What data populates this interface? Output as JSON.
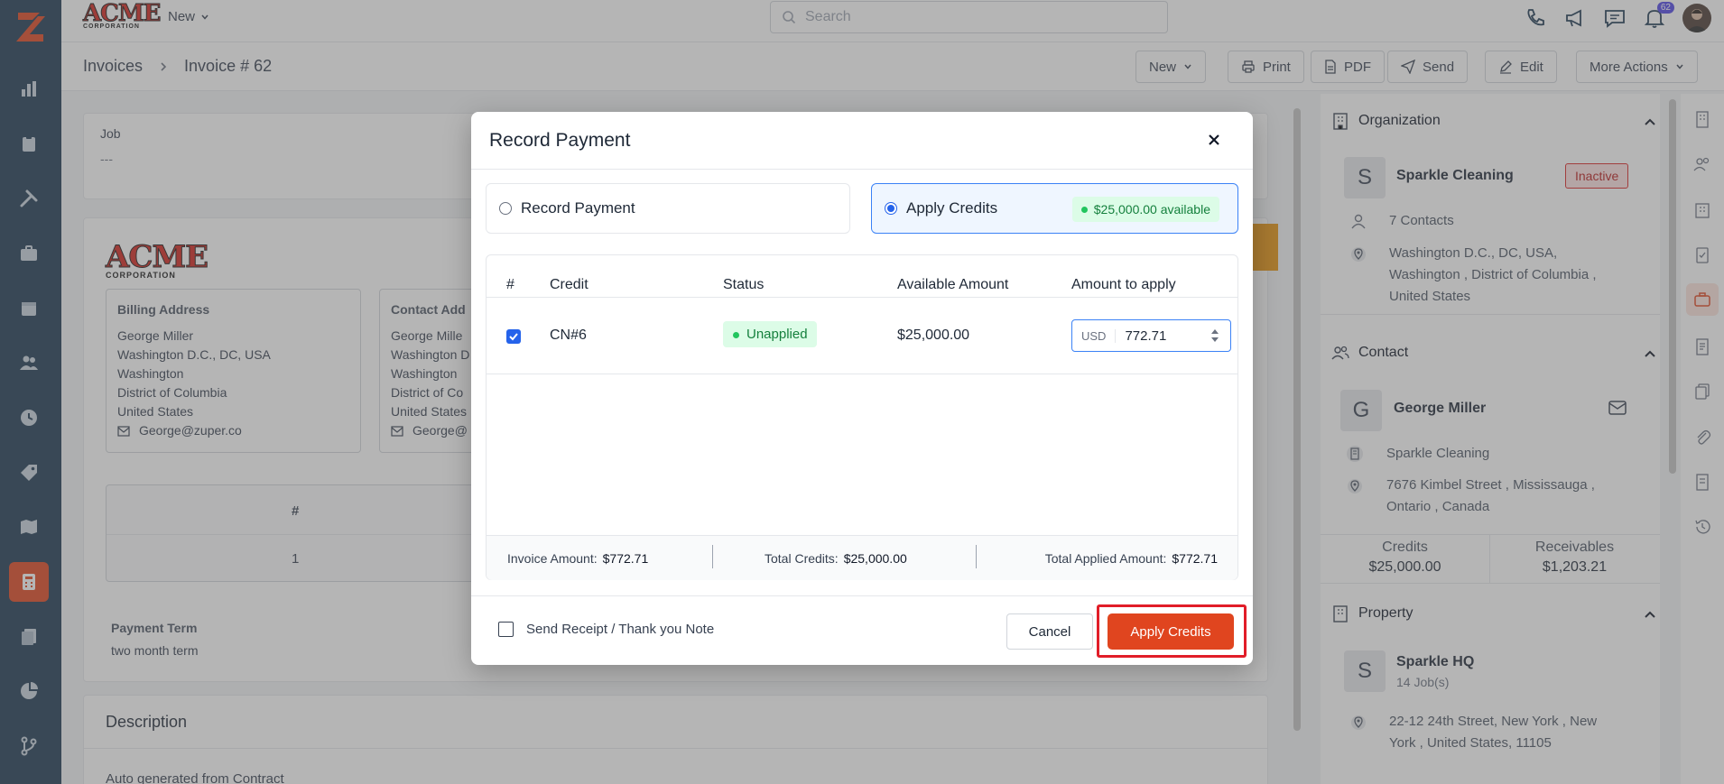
{
  "colors": {
    "sidebar": "#1e3a52",
    "accent": "#e0451f",
    "highlight": "#e11d28",
    "primary": "#2563eb",
    "success": "#15803d"
  },
  "brand": {
    "word": "ACME",
    "sub": "CORPORATION"
  },
  "topbar": {
    "new_label": "New",
    "search_placeholder": "Search",
    "notifications_count": "62",
    "icons": [
      "phone-icon",
      "megaphone-icon",
      "chat-icon",
      "bell-icon"
    ]
  },
  "sidebar": {
    "items": [
      "reports",
      "jobs",
      "tools",
      "briefcase",
      "calendar",
      "users",
      "timesheet",
      "tags",
      "map",
      "invoices",
      "documents",
      "analytics",
      "workflows"
    ],
    "active": "invoices"
  },
  "breadcrumb": {
    "parent": "Invoices",
    "current": "Invoice # 62"
  },
  "toolbar": {
    "new": "New",
    "print": "Print",
    "pdf": "PDF",
    "send": "Send",
    "edit": "Edit",
    "more": "More Actions"
  },
  "job": {
    "label": "Job",
    "value": "---"
  },
  "billing": {
    "title": "Billing Address",
    "lines": [
      "George Miller",
      "Washington D.C., DC, USA",
      "Washington",
      "District of Columbia",
      "United States"
    ],
    "email": "George@zuper.co"
  },
  "contact_address": {
    "title": "Contact Add",
    "lines": [
      "George Mille",
      "Washington D",
      "Washington",
      "District of Co",
      "United States"
    ],
    "email": "George@"
  },
  "line_table": {
    "col_num": "#",
    "row_num": "1"
  },
  "payment_term": {
    "label": "Payment Term",
    "value": "two month term"
  },
  "description": {
    "title": "Description",
    "text": "Auto generated from Contract"
  },
  "right_panel": {
    "organization": {
      "title": "Organization",
      "initial": "S",
      "name": "Sparkle Cleaning",
      "status": "Inactive",
      "contacts": "7 Contacts",
      "address": [
        "Washington D.C., DC, USA,",
        "Washington , District of Columbia ,",
        "United States"
      ]
    },
    "contact": {
      "title": "Contact",
      "initial": "G",
      "name": "George Miller",
      "org": "Sparkle Cleaning",
      "address": [
        "7676 Kimbel Street , Mississauga ,",
        "Ontario , Canada"
      ],
      "credits_label": "Credits",
      "credits_value": "$25,000.00",
      "receivables_label": "Receivables",
      "receivables_value": "$1,203.21"
    },
    "property": {
      "title": "Property",
      "initial": "S",
      "name": "Sparkle HQ",
      "jobs": "14 Job(s)",
      "address": [
        "22-12 24th Street, New York , New",
        "York , United States, 11105"
      ]
    }
  },
  "modal": {
    "title": "Record Payment",
    "option_record": "Record Payment",
    "option_apply": "Apply Credits",
    "available_badge": "$25,000.00 available",
    "columns": {
      "num": "#",
      "credit": "Credit",
      "status": "Status",
      "available": "Available Amount",
      "apply": "Amount to apply"
    },
    "rows": [
      {
        "credit": "CN#6",
        "status": "Unapplied",
        "available": "$25,000.00",
        "currency": "USD",
        "amount": "772.71",
        "checked": true
      }
    ],
    "footer": {
      "invoice_label": "Invoice Amount:",
      "invoice_value": "$772.71",
      "credits_label": "Total Credits:",
      "credits_value": "$25,000.00",
      "applied_label": "Total Applied Amount:",
      "applied_value": "$772.71"
    },
    "receipt_label": "Send Receipt / Thank you Note",
    "cancel": "Cancel",
    "apply": "Apply Credits"
  }
}
